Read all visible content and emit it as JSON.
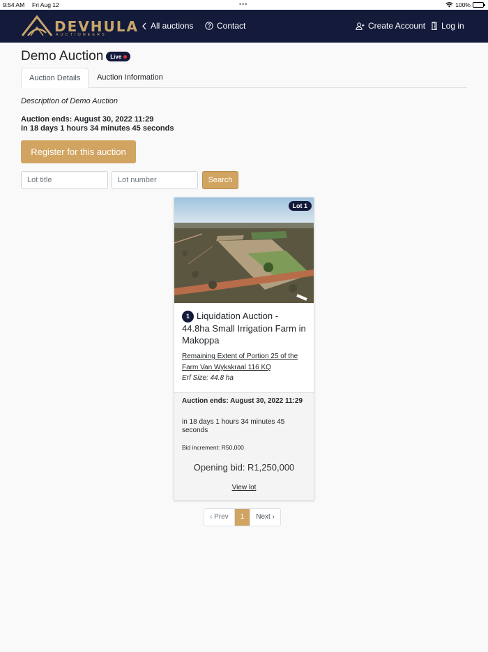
{
  "status_bar": {
    "time": "9:54 AM",
    "date": "Fri Aug 12",
    "battery": "100%"
  },
  "nav": {
    "brand": "DEVHULA",
    "brand_sub": "AUCTIONEERS",
    "all_auctions": "All auctions",
    "contact": "Contact",
    "create_account": "Create Account",
    "log_in": "Log in"
  },
  "auction": {
    "title": "Demo Auction",
    "live_badge": "Live",
    "description": "Description of Demo Auction",
    "ends": "Auction ends: August 30, 2022 11:29",
    "countdown": "in 18 days 1 hours 34 minutes 45 seconds",
    "register_label": "Register for this auction"
  },
  "tabs": [
    {
      "label": "Auction Details",
      "active": true
    },
    {
      "label": "Auction Information",
      "active": false
    }
  ],
  "search": {
    "lot_title_placeholder": "Lot title",
    "lot_number_placeholder": "Lot number",
    "button_label": "Search"
  },
  "lot": {
    "badge": "Lot 1",
    "number": "1",
    "title": "Liquidation Auction - 44.8ha Small Irrigation Farm in Makoppa",
    "property_link": "Remaining Extent of Portion 25 of the Farm Van Wykskraal 116 KQ",
    "erf_size": "Erf Size: 44.8 ha",
    "ends": "Auction ends: August 30, 2022 11:29",
    "countdown": "in 18 days 1 hours 34 minutes 45 seconds",
    "bid_increment": "Bid increment: R50,000",
    "opening_bid": "Opening bid: R1,250,000",
    "view_lot": "View lot"
  },
  "pagination": {
    "prev": "‹ Prev",
    "current": "1",
    "next": "Next ›"
  },
  "colors": {
    "navy": "#131a3a",
    "gold": "#d1a461",
    "live_dot": "#e3342f"
  }
}
